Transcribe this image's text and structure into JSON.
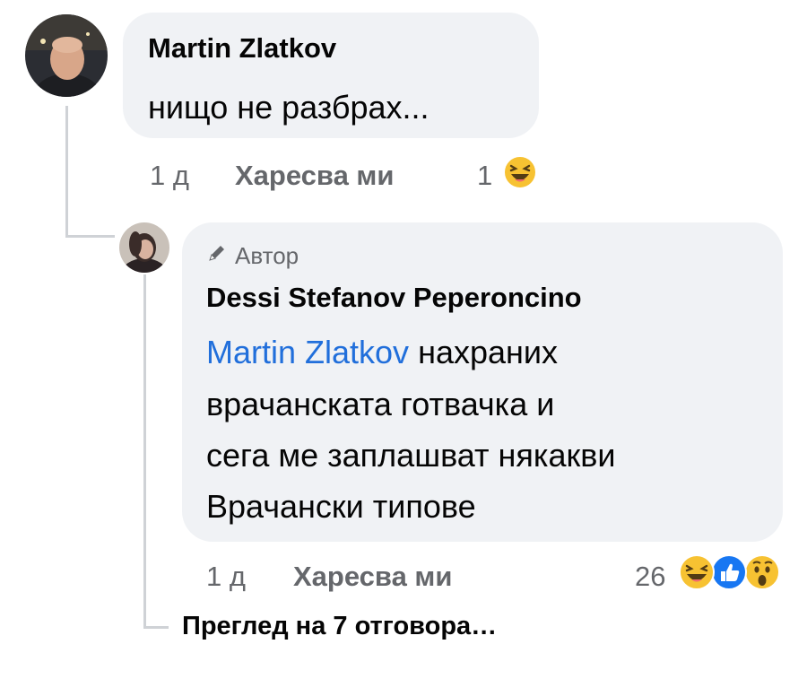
{
  "comments": [
    {
      "author": "Martin Zlatkov",
      "text": "нищо не разбрах...",
      "time": "1 д",
      "like_label": "Харесва ми",
      "reaction_count": "1",
      "reactions": [
        "haha"
      ]
    },
    {
      "author_badge": "Автор",
      "author": "Dessi Stefanov Peperoncino",
      "mention": "Martin Zlatkov",
      "text_lines": [
        "нахраних",
        "врачанската готвачка и",
        "сега ме заплашват някакви",
        "Врачански типове"
      ],
      "time": "1 д",
      "like_label": "Харесва ми",
      "reaction_count": "26",
      "reactions": [
        "haha",
        "like",
        "wow"
      ]
    }
  ],
  "view_replies_label": "Преглед на 7 отговора…",
  "colors": {
    "bubble": "#f0f2f5",
    "mention": "#216fdb",
    "meta": "#65676b",
    "like_blue": "#1877f2",
    "emoji_yellow": "#f7c232"
  }
}
